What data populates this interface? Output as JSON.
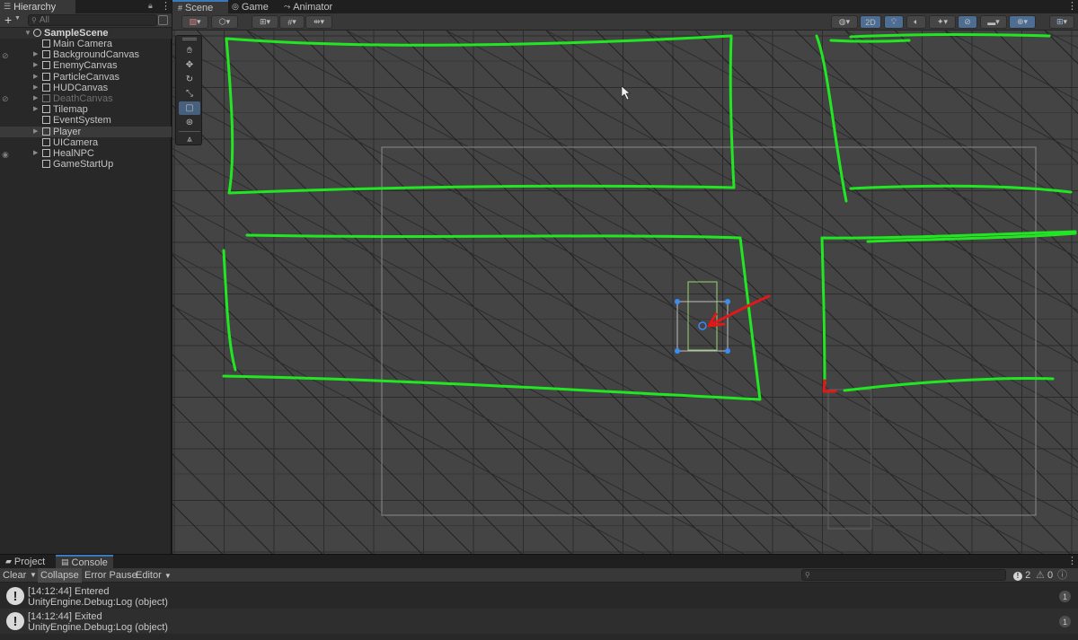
{
  "hierarchy": {
    "tab_label": "Hierarchy",
    "add_label": "+",
    "search_placeholder": "All",
    "scene_name": "SampleScene",
    "items": [
      {
        "label": "Main Camera",
        "expandable": false,
        "dim": false,
        "selected": false
      },
      {
        "label": "BackgroundCanvas",
        "expandable": true,
        "dim": false,
        "selected": false
      },
      {
        "label": "EnemyCanvas",
        "expandable": true,
        "dim": false,
        "selected": false
      },
      {
        "label": "ParticleCanvas",
        "expandable": true,
        "dim": false,
        "selected": false
      },
      {
        "label": "HUDCanvas",
        "expandable": true,
        "dim": false,
        "selected": false
      },
      {
        "label": "DeathCanvas",
        "expandable": true,
        "dim": true,
        "selected": false
      },
      {
        "label": "Tilemap",
        "expandable": true,
        "dim": false,
        "selected": false
      },
      {
        "label": "EventSystem",
        "expandable": false,
        "dim": false,
        "selected": false
      },
      {
        "label": "Player",
        "expandable": true,
        "dim": false,
        "selected": true
      },
      {
        "label": "UICamera",
        "expandable": false,
        "dim": false,
        "selected": false
      },
      {
        "label": "HealNPC",
        "expandable": true,
        "dim": false,
        "selected": false
      },
      {
        "label": "GameStartUp",
        "expandable": false,
        "dim": false,
        "selected": false
      }
    ]
  },
  "scene_tabs": [
    {
      "label": "Scene",
      "icon": "grid-icon",
      "active": true
    },
    {
      "label": "Game",
      "icon": "gamepad-icon",
      "active": false
    },
    {
      "label": "Animator",
      "icon": "animator-icon",
      "active": false
    }
  ],
  "scene_toolbar": {
    "mode_2d": "2D"
  },
  "tools": [
    "hand-tool",
    "move-tool",
    "rotate-tool",
    "scale-tool",
    "rect-tool",
    "transform-tool",
    "custom-tool"
  ],
  "bottom_tabs": [
    {
      "label": "Project",
      "icon": "folder-icon",
      "active": false
    },
    {
      "label": "Console",
      "icon": "console-icon",
      "active": true
    }
  ],
  "console_toolbar": {
    "clear": "Clear",
    "collapse": "Collapse",
    "error_pause": "Error Pause",
    "editor": "Editor",
    "info_count": "2",
    "warning_count": "0",
    "error_count": "0"
  },
  "console_logs": [
    {
      "line1": "[14:12:44] Entered",
      "line2": "UnityEngine.Debug:Log (object)",
      "count": "1"
    },
    {
      "line1": "[14:12:44] Exited",
      "line2": "UnityEngine.Debug:Log (object)",
      "count": "1"
    }
  ],
  "colors": {
    "annotation_green": "#22e622",
    "annotation_red": "#e01818",
    "selection_blue": "#3a79bb",
    "viewport_bg": "#444444"
  }
}
